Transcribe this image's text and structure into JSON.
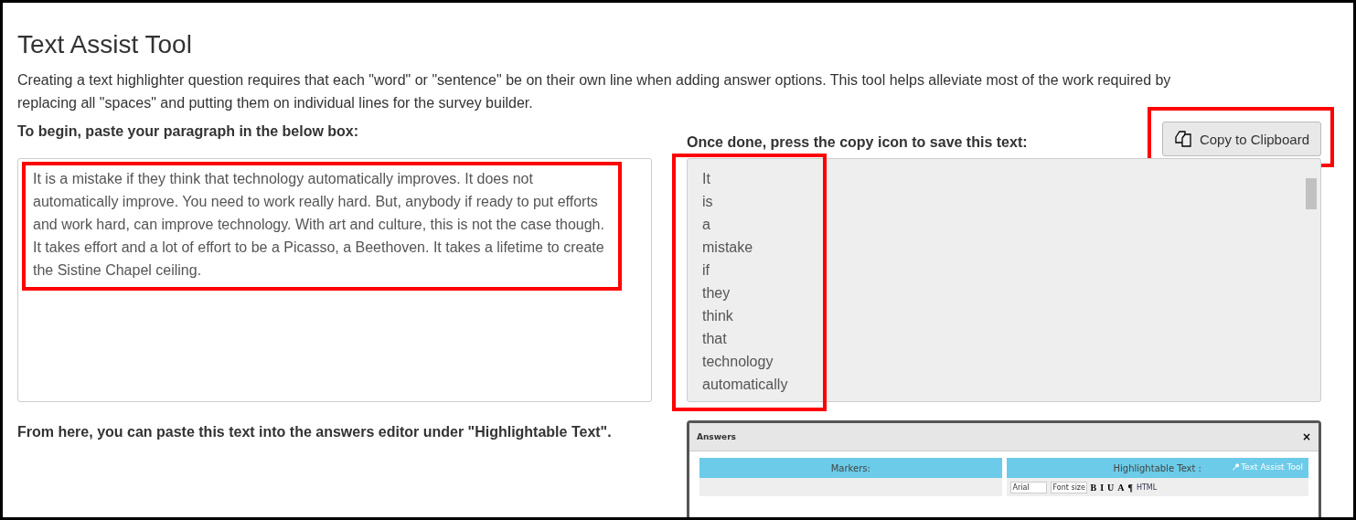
{
  "title": "Text Assist Tool",
  "intro": "Creating a text highlighter question requires that each \"word\" or \"sentence\" be on their own line when adding answer options. This tool helps alleviate most of the work required by replacing all \"spaces\" and putting them on individual lines for the survey builder.",
  "input": {
    "label": "To begin, paste your paragraph in the below box:",
    "value": "It is a mistake if they think that technology automatically improves. It does not automatically improve. You need to work really hard. But, anybody if ready to put efforts and work hard, can improve technology. With art and culture, this is not the case though. It takes effort and a lot of effort to be a Picasso, a Beethoven. It takes a lifetime to create the Sistine Chapel ceiling.",
    "highlighted": true
  },
  "output": {
    "label": "Once done, press the copy icon to save this text:",
    "lines": [
      "It",
      "is",
      "a",
      "mistake",
      "if",
      "they",
      "think",
      "that",
      "technology",
      "automatically"
    ],
    "highlighted": true
  },
  "copy_button": {
    "label": "Copy to Clipboard",
    "highlighted": true
  },
  "note": "From here, you can paste this text into the answers editor under \"Highlightable Text\".",
  "embedded_dialog": {
    "title": "Answers",
    "close": "×",
    "columns": [
      "Markers:",
      "Highlightable Text :"
    ],
    "tool_link": "Text Assist Tool",
    "toolbar": {
      "font": "Arial",
      "size": "Font size",
      "buttons": [
        "B",
        "I",
        "U",
        "A",
        "¶"
      ],
      "html": "HTML"
    }
  }
}
